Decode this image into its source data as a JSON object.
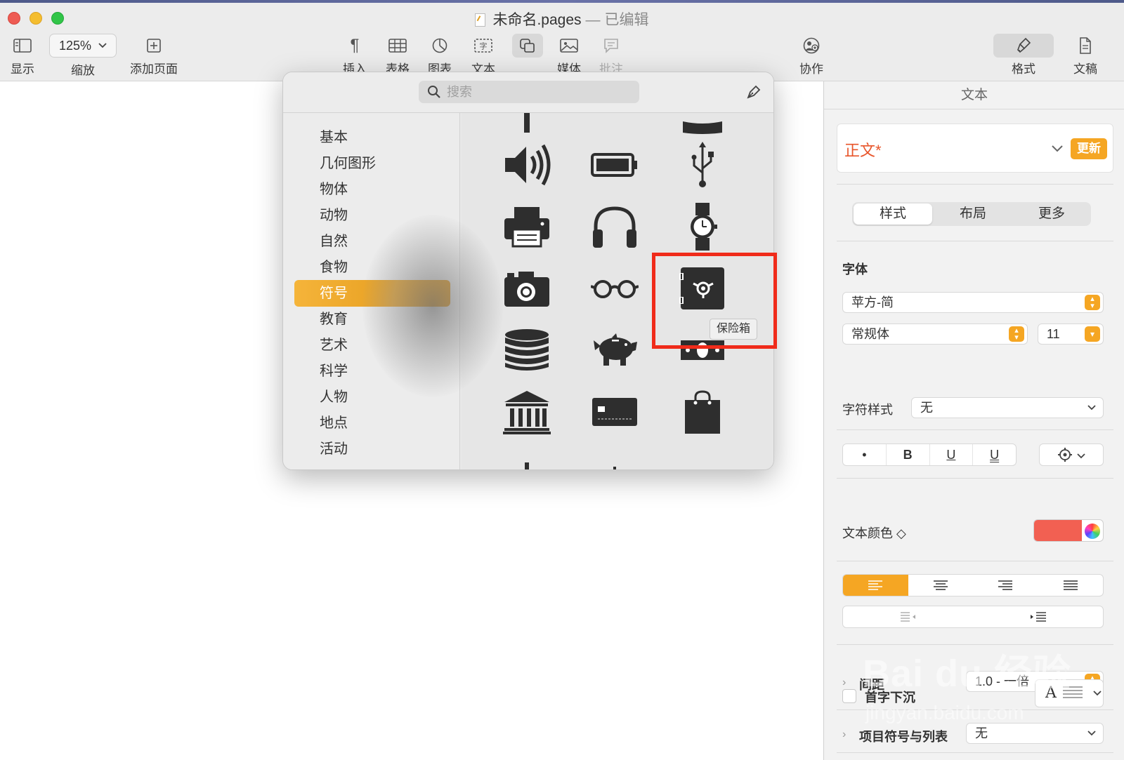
{
  "window": {
    "title": "未命名.pages",
    "separator": "—",
    "status": "已编辑"
  },
  "toolbar": {
    "display_label": "显示",
    "zoom_value": "125%",
    "zoom_label": "缩放",
    "add_page_label": "添加页面",
    "insert_label": "插入",
    "table_label": "表格",
    "chart_label": "图表",
    "text_label": "文本",
    "shape_label": "形状",
    "media_label": "媒体",
    "comment_label": "批注",
    "collaborate_label": "协作",
    "format_label": "格式",
    "document_label": "文稿"
  },
  "shape_popover": {
    "search_placeholder": "搜索",
    "categories": [
      "基本",
      "几何图形",
      "物体",
      "动物",
      "自然",
      "食物",
      "符号",
      "教育",
      "艺术",
      "科学",
      "人物",
      "地点",
      "活动"
    ],
    "selected_category": "符号",
    "shapes": [
      "speaker",
      "battery",
      "usb",
      "printer",
      "headphones",
      "watch",
      "camera",
      "glasses",
      "safe",
      "coins",
      "piggy-bank",
      "money",
      "bank",
      "credit-card",
      "shopping-bag"
    ],
    "hovered_shape_tooltip": "保险箱",
    "highlight_color": "#f02b1a"
  },
  "inspector": {
    "header": "文本",
    "paragraph_style": "正文*",
    "update_button": "更新",
    "tabs": [
      "样式",
      "布局",
      "更多"
    ],
    "active_tab": "样式",
    "font_section": "字体",
    "font_family": "苹方-简",
    "font_weight": "常规体",
    "font_size": "11",
    "style_buttons": [
      "•",
      "B",
      "U",
      "U"
    ],
    "char_style_label": "字符样式",
    "char_style_value": "无",
    "text_color_label": "文本颜色 ◇",
    "text_color": "#f26052",
    "spacing_label": "间距",
    "spacing_value": "1.0 - 一倍",
    "bullets_label": "项目符号与列表",
    "bullets_value": "无",
    "dropcap_label": "首字下沉",
    "dropcap_glyph": "A",
    "accent_color": "#f5a623"
  },
  "watermark": {
    "brand": "Bai du 经验",
    "url": "jingyan.baidu.com"
  }
}
